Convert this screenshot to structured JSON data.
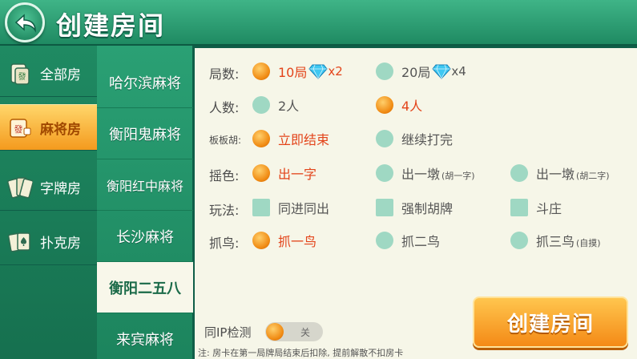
{
  "header": {
    "title": "创建房间",
    "back_icon": "back-arrow-icon"
  },
  "categories": [
    {
      "label": "全部房",
      "icon": "mahjong-tile-icon",
      "active": false
    },
    {
      "label": "麻将房",
      "icon": "mahjong-tile-icon",
      "active": true
    },
    {
      "label": "字牌房",
      "icon": "zipai-cards-icon",
      "active": false
    },
    {
      "label": "扑克房",
      "icon": "poker-cards-icon",
      "active": false
    }
  ],
  "games": [
    {
      "label": "哈尔滨麻将",
      "active": false
    },
    {
      "label": "衡阳鬼麻将",
      "active": false
    },
    {
      "label": "衡阳红中麻将",
      "active": false
    },
    {
      "label": "长沙麻将",
      "active": false
    },
    {
      "label": "衡阳二五八",
      "active": true
    },
    {
      "label": "来宾麻将",
      "active": false
    }
  ],
  "options": {
    "rounds": {
      "label": "局数:",
      "items": [
        {
          "text": "10局",
          "gem_mult": "x2",
          "selected": true
        },
        {
          "text": "20局",
          "gem_mult": "x4",
          "selected": false
        }
      ]
    },
    "players": {
      "label": "人数:",
      "items": [
        {
          "text": "2人",
          "selected": false
        },
        {
          "text": "4人",
          "selected": true
        }
      ]
    },
    "banban_hu": {
      "label": "板板胡:",
      "items": [
        {
          "text": "立即结束",
          "selected": true
        },
        {
          "text": "继续打完",
          "selected": false
        }
      ]
    },
    "dice": {
      "label": "摇色:",
      "items": [
        {
          "text": "出一字",
          "note": "",
          "selected": true
        },
        {
          "text": "出一墩",
          "note": "(胡一字)",
          "selected": false
        },
        {
          "text": "出一墩",
          "note": "(胡二字)",
          "selected": false
        }
      ]
    },
    "play_rules": {
      "label": "玩法:",
      "items": [
        {
          "text": "同进同出",
          "checked": false
        },
        {
          "text": "强制胡牌",
          "checked": false
        },
        {
          "text": "斗庄",
          "checked": false
        }
      ]
    },
    "catch_bird": {
      "label": "抓鸟:",
      "items": [
        {
          "text": "抓一鸟",
          "note": "",
          "selected": true
        },
        {
          "text": "抓二鸟",
          "note": "",
          "selected": false
        },
        {
          "text": "抓三鸟",
          "note": "(自摸)",
          "selected": false
        }
      ]
    }
  },
  "ip_check": {
    "label": "同IP检测",
    "state_text": "关"
  },
  "note": "注: 房卡在第一局牌局结束后扣除, 提前解散不扣房卡",
  "create_button": {
    "label": "创建房间"
  },
  "colors": {
    "accent_orange": "#f48a16",
    "selected_text": "#e3441a",
    "panel_bg": "#f6f6e8",
    "header_green": "#1f8a62"
  }
}
